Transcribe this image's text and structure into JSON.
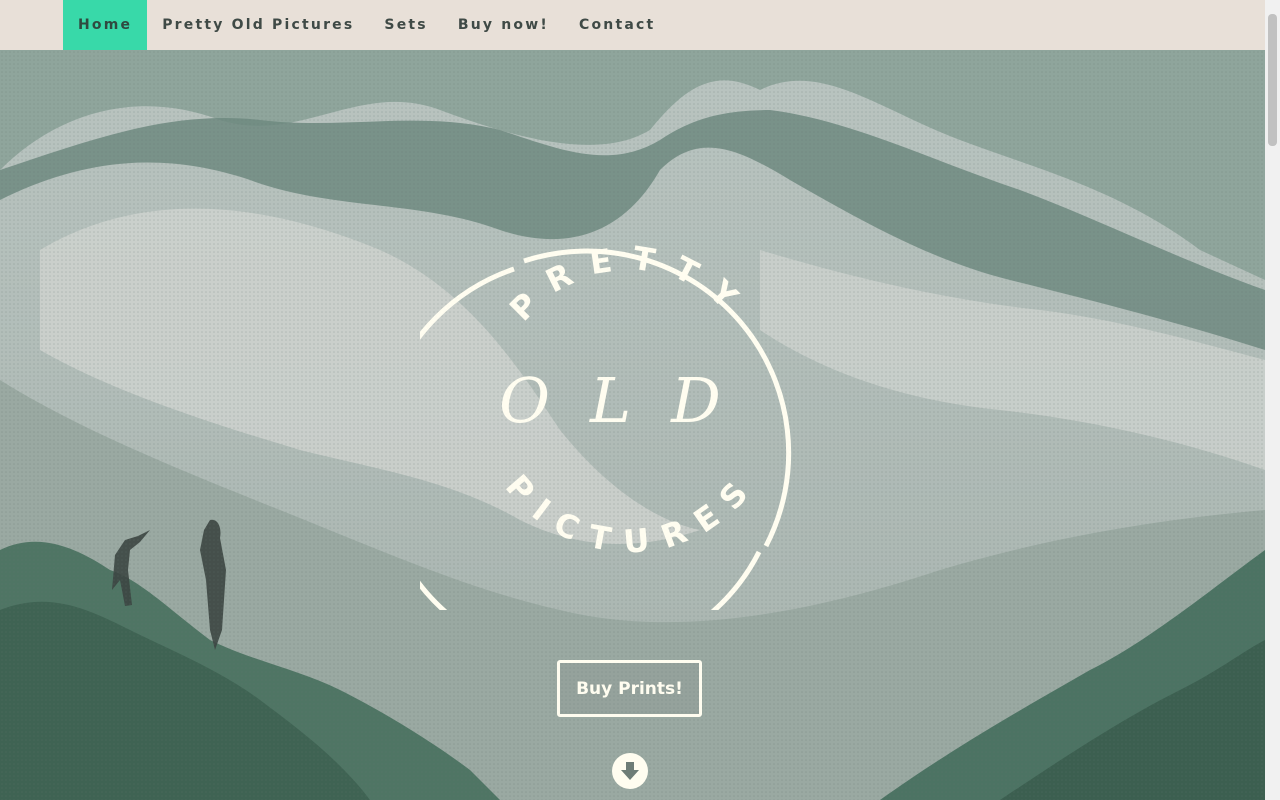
{
  "nav": {
    "items": [
      {
        "label": "Home",
        "active": true
      },
      {
        "label": "Pretty Old Pictures",
        "active": false
      },
      {
        "label": "Sets",
        "active": false
      },
      {
        "label": "Buy now!",
        "active": false
      },
      {
        "label": "Contact",
        "active": false
      }
    ]
  },
  "logo": {
    "top_text": "PRETTY",
    "middle_text": "OLD",
    "bottom_text": "PICTURES"
  },
  "hero": {
    "cta_label": "Buy Prints!",
    "scroll_icon": "arrow-down-circle-icon"
  },
  "colors": {
    "nav_bg": "#e8e0d8",
    "nav_active": "#38d9a9",
    "nav_text": "#3f4a46",
    "logo_color": "#fffdf0"
  }
}
